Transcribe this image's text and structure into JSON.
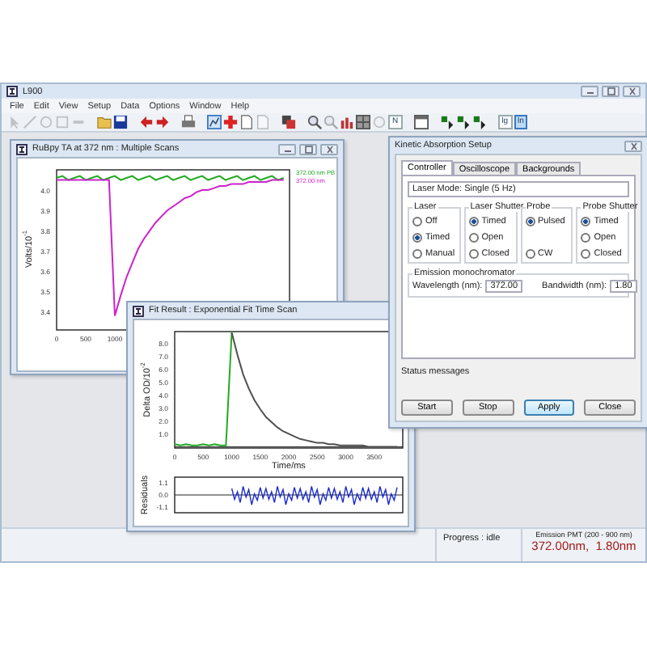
{
  "window": {
    "title": "L900",
    "menu": [
      "File",
      "Edit",
      "View",
      "Setup",
      "Data",
      "Options",
      "Window",
      "Help"
    ]
  },
  "toolbar_toggles": [
    {
      "label": "N",
      "selected": false
    },
    {
      "label": "lg",
      "selected": false
    },
    {
      "label": "ln",
      "selected": true
    }
  ],
  "scan_window": {
    "title": "RuBpy TA at 372 nm : Multiple Scans",
    "chart_data": {
      "type": "line",
      "ylabel": "Volts/10$^{-1}$",
      "xlim": [
        0,
        4000
      ],
      "ylim": [
        3.31,
        4.1
      ],
      "xticks": [
        0,
        500,
        1000
      ],
      "yticks": [
        {
          "value": 4.0,
          "label": "4.0"
        },
        {
          "value": 3.9,
          "label": "3.9"
        },
        {
          "value": 3.8,
          "label": "3.8"
        },
        {
          "value": 3.7,
          "label": "3.7"
        },
        {
          "value": 3.6,
          "label": "3.6"
        },
        {
          "value": 3.5,
          "label": "3.5"
        },
        {
          "value": 3.4,
          "label": "3.4"
        }
      ],
      "x": [
        0,
        100,
        200,
        300,
        400,
        500,
        600,
        700,
        800,
        900,
        1000,
        1100,
        1200,
        1300,
        1400,
        1500,
        1600,
        1700,
        1800,
        1900,
        2000,
        2100,
        2200,
        2300,
        2400,
        2500,
        2600,
        2700,
        2800,
        2900,
        3000,
        3100,
        3200,
        3300,
        3400,
        3500,
        3600,
        3700,
        3800,
        3900
      ],
      "series": [
        {
          "name": "372.00 nm PB",
          "color": "#22aa22",
          "values": [
            4.06,
            4.07,
            4.05,
            4.06,
            4.07,
            4.05,
            4.06,
            4.07,
            4.05,
            4.06,
            4.07,
            4.05,
            4.06,
            4.07,
            4.05,
            4.06,
            4.07,
            4.05,
            4.06,
            4.07,
            4.05,
            4.06,
            4.07,
            4.05,
            4.06,
            4.07,
            4.05,
            4.06,
            4.07,
            4.05,
            4.06,
            4.07,
            4.05,
            4.06,
            4.07,
            4.05,
            4.06,
            4.07,
            4.05,
            4.06
          ]
        },
        {
          "name": "372.00 nm",
          "color": "#cc22cc",
          "values": [
            4.05,
            4.05,
            4.05,
            4.05,
            4.05,
            4.05,
            4.05,
            4.05,
            4.05,
            4.05,
            3.38,
            3.48,
            3.57,
            3.64,
            3.71,
            3.76,
            3.8,
            3.84,
            3.87,
            3.9,
            3.92,
            3.94,
            3.96,
            3.97,
            3.99,
            4.0,
            4.0,
            4.01,
            4.02,
            4.02,
            4.03,
            4.03,
            4.03,
            4.04,
            4.04,
            4.04,
            4.04,
            4.05,
            4.05,
            4.05
          ]
        }
      ]
    }
  },
  "fit_window": {
    "title": "Fit Result : Exponential Fit Time Scan",
    "chart_data": {
      "type": "line",
      "xlabel": "Time/ms",
      "ylabel": "Delta OD/10$^{-2}$",
      "xlim": [
        0,
        4000
      ],
      "ylim": [
        -0.1,
        8.9
      ],
      "xticks": [
        0,
        500,
        1000,
        1500,
        2000,
        2500,
        3000,
        3500
      ],
      "yticks": [
        {
          "value": 1,
          "label": "1.0"
        },
        {
          "value": 2,
          "label": "2.0"
        },
        {
          "value": 3,
          "label": "3.0"
        },
        {
          "value": 4,
          "label": "4.0"
        },
        {
          "value": 5,
          "label": "5.0"
        },
        {
          "value": 6,
          "label": "6.0"
        },
        {
          "value": 7,
          "label": "7.0"
        },
        {
          "value": 8,
          "label": "8.0"
        }
      ],
      "x": [
        0,
        100,
        200,
        300,
        400,
        500,
        600,
        700,
        800,
        900,
        1000,
        1100,
        1200,
        1300,
        1400,
        1500,
        1600,
        1700,
        1800,
        1900,
        2000,
        2100,
        2200,
        2300,
        2400,
        2500,
        2600,
        2700,
        2800,
        2900,
        3000,
        3100,
        3200,
        3300,
        3400,
        3500,
        3600,
        3700,
        3800,
        3900
      ],
      "series": [
        {
          "color": "#22aa22",
          "values": [
            0.2,
            0.1,
            0.2,
            0.1,
            0.1,
            0.2,
            0.1,
            0.2,
            0.1,
            0.1,
            8.9,
            null,
            null,
            null,
            null,
            null,
            null,
            null,
            null,
            null,
            null,
            null,
            null,
            null,
            null,
            null,
            null,
            null,
            null,
            null,
            null,
            null,
            null,
            null,
            null,
            null,
            null,
            null,
            null,
            null
          ]
        },
        {
          "color": "#505050",
          "values": [
            null,
            null,
            null,
            null,
            null,
            null,
            null,
            null,
            null,
            null,
            8.8,
            7.1,
            5.6,
            4.5,
            3.6,
            2.9,
            2.3,
            1.9,
            1.5,
            1.2,
            1.0,
            0.8,
            0.6,
            0.5,
            0.4,
            0.3,
            0.3,
            0.2,
            0.2,
            0.1,
            0.1,
            0.1,
            0.1,
            0.1,
            0.0,
            0.0,
            0.0,
            0.0,
            0.0,
            0.0
          ]
        }
      ]
    },
    "residuals": {
      "chart_data": {
        "type": "line",
        "ylabel": "Residuals",
        "xlim": [
          0,
          4000
        ],
        "ylim": [
          -1.65,
          1.65
        ],
        "yticks": [
          {
            "value": 1.1,
            "label": "1.1"
          },
          {
            "value": 0,
            "label": "0.0"
          },
          {
            "value": -1.1,
            "label": "-1.1"
          }
        ],
        "x": [
          1000,
          1050,
          1100,
          1150,
          1200,
          1250,
          1300,
          1350,
          1400,
          1450,
          1500,
          1550,
          1600,
          1650,
          1700,
          1750,
          1800,
          1850,
          1900,
          1950,
          2000,
          2050,
          2100,
          2150,
          2200,
          2250,
          2300,
          2350,
          2400,
          2450,
          2500,
          2550,
          2600,
          2650,
          2700,
          2750,
          2800,
          2850,
          2900,
          2950,
          3000,
          3050,
          3100,
          3150,
          3200,
          3250,
          3300,
          3350,
          3400,
          3450,
          3500,
          3550,
          3600,
          3650,
          3700,
          3750,
          3800,
          3850,
          3900
        ],
        "series": [
          {
            "color": "#1a2ad0",
            "values": [
              0.6,
              -0.4,
              0.3,
              -0.7,
              0.8,
              -0.2,
              0.5,
              -0.9,
              0.1,
              -0.5,
              0.7,
              -0.3,
              0.6,
              -0.4,
              0.3,
              -0.7,
              0.8,
              -0.2,
              0.5,
              -0.9,
              0.1,
              -0.5,
              0.7,
              -0.3,
              0.6,
              -0.4,
              0.3,
              -0.7,
              0.8,
              -0.2,
              0.5,
              -0.9,
              0.1,
              -0.5,
              0.7,
              -0.3,
              0.6,
              -0.4,
              0.3,
              -0.7,
              0.8,
              -0.2,
              0.5,
              -0.9,
              0.1,
              -0.5,
              0.7,
              -0.3,
              0.6,
              -0.4,
              0.3,
              -0.7,
              0.8,
              -0.2,
              0.5,
              -0.9,
              0.1,
              -0.5,
              0.7
            ]
          }
        ]
      }
    }
  },
  "setup_dialog": {
    "title": "Kinetic Absorption Setup",
    "tabs": [
      {
        "label": "Controller",
        "selected": true
      },
      {
        "label": "Oscilloscope",
        "selected": false
      },
      {
        "label": "Backgrounds",
        "selected": false
      }
    ],
    "laser_mode": "Laser Mode: Single (5 Hz)",
    "groups": [
      {
        "label": "Laser",
        "options": [
          {
            "label": "Off",
            "selected": false
          },
          {
            "label": "Timed",
            "selected": true
          },
          {
            "label": "Manual",
            "selected": false
          }
        ]
      },
      {
        "label": "Laser Shutter",
        "options": [
          {
            "label": "Timed",
            "selected": true
          },
          {
            "label": "Open",
            "selected": false
          },
          {
            "label": "Closed",
            "selected": false
          }
        ]
      },
      {
        "label": "Probe",
        "options": [
          {
            "label": "Pulsed",
            "selected": true
          },
          {
            "label": "CW",
            "selected": false
          }
        ]
      },
      {
        "label": "Probe Shutter",
        "options": [
          {
            "label": "Timed",
            "selected": true
          },
          {
            "label": "Open",
            "selected": false
          },
          {
            "label": "Closed",
            "selected": false
          }
        ]
      }
    ],
    "emission_group": "Emission monochromator",
    "fields": [
      {
        "label": "Wavelength (nm):",
        "value": "372.00"
      },
      {
        "label": "Bandwidth (nm):",
        "value": "1.80"
      }
    ],
    "status_label": "Status messages",
    "buttons": [
      {
        "label": "Start",
        "default": false
      },
      {
        "label": "Stop",
        "default": false
      },
      {
        "label": "Apply",
        "default": true
      },
      {
        "label": "Close",
        "default": false
      }
    ]
  },
  "status_bar": {
    "progress": "Progress : idle",
    "detector": "Emission PMT (200 - 900 nm)",
    "reading": "372.00nm,  1.80nm"
  }
}
